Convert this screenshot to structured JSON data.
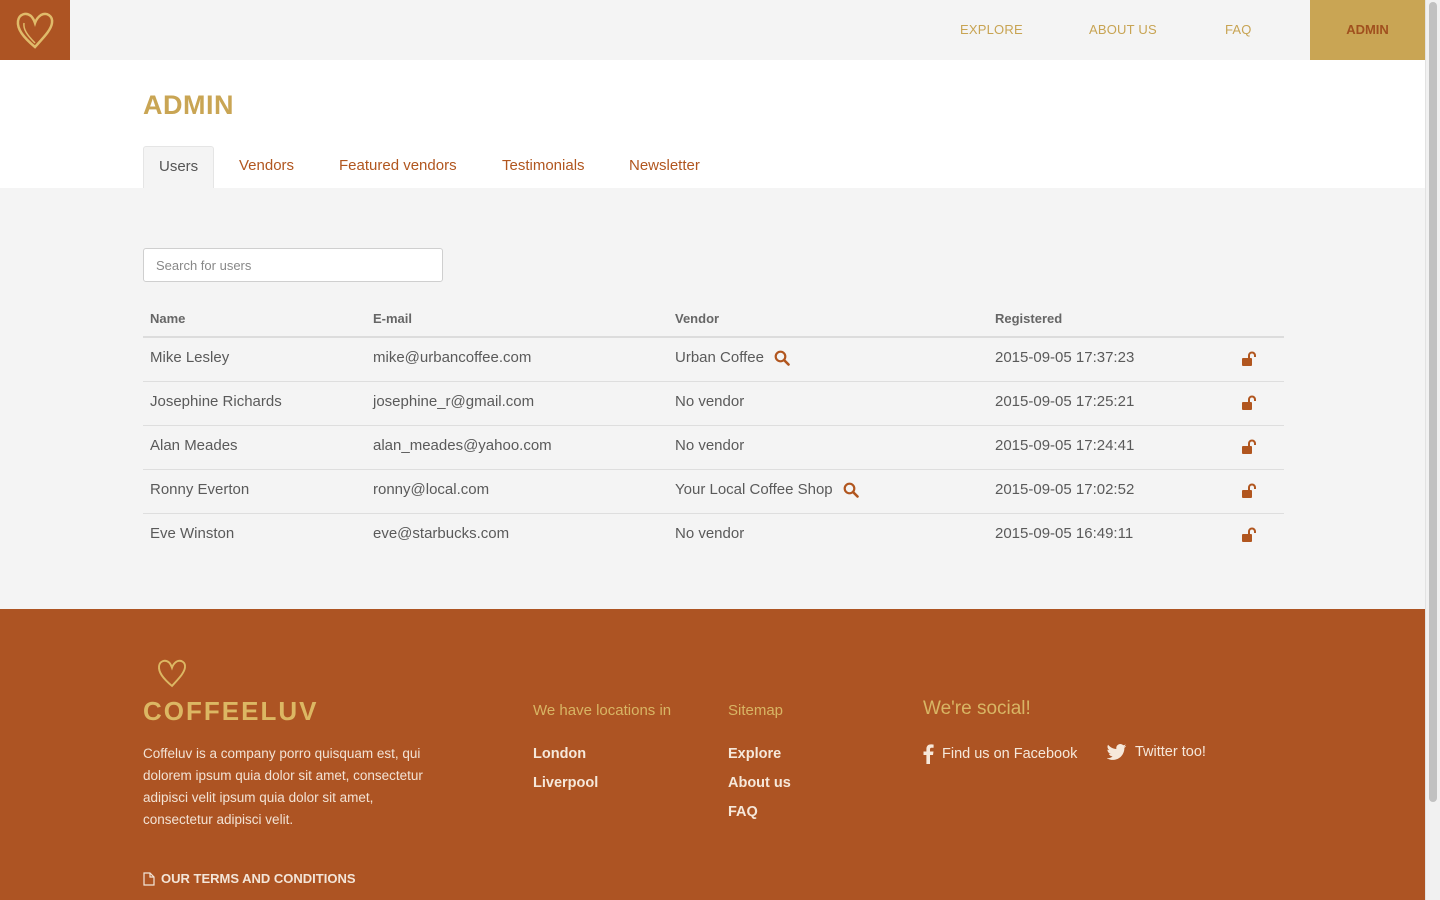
{
  "nav": {
    "items": [
      {
        "label": "EXPLORE"
      },
      {
        "label": "ABOUT US"
      },
      {
        "label": "FAQ"
      }
    ],
    "active_label": "ADMIN"
  },
  "page": {
    "title": "ADMIN",
    "tabs": [
      {
        "label": "Users",
        "active": true
      },
      {
        "label": "Vendors"
      },
      {
        "label": "Featured vendors"
      },
      {
        "label": "Testimonials"
      },
      {
        "label": "Newsletter"
      }
    ]
  },
  "users": {
    "search_placeholder": "Search for users",
    "columns": [
      "Name",
      "E-mail",
      "Vendor",
      "Registered"
    ],
    "rows": [
      {
        "name": "Mike Lesley",
        "email": "mike@urbancoffee.com",
        "vendor": "Urban Coffee",
        "has_vendor": true,
        "registered": "2015-09-05 17:37:23"
      },
      {
        "name": "Josephine Richards",
        "email": "josephine_r@gmail.com",
        "vendor": "No vendor",
        "has_vendor": false,
        "registered": "2015-09-05 17:25:21"
      },
      {
        "name": "Alan Meades",
        "email": "alan_meades@yahoo.com",
        "vendor": "No vendor",
        "has_vendor": false,
        "registered": "2015-09-05 17:24:41"
      },
      {
        "name": "Ronny Everton",
        "email": "ronny@local.com",
        "vendor": "Your Local Coffee Shop",
        "has_vendor": true,
        "registered": "2015-09-05 17:02:52"
      },
      {
        "name": "Eve Winston",
        "email": "eve@starbucks.com",
        "vendor": "No vendor",
        "has_vendor": false,
        "registered": "2015-09-05 16:49:11"
      }
    ]
  },
  "footer": {
    "brand": "COFFEELUV",
    "about": "Coffeluv is a company porro quisquam est, qui dolorem ipsum quia dolor sit amet, consectetur adipisci velit ipsum quia dolor sit amet, consectetur adipisci velit.",
    "terms": "OUR TERMS AND CONDITIONS",
    "locations_title": "We have locations in",
    "locations": [
      "London",
      "Liverpool"
    ],
    "sitemap_title": "Sitemap",
    "sitemap": [
      "Explore",
      "About us",
      "FAQ"
    ],
    "social_title": "We're social!",
    "facebook": "Find us on Facebook",
    "twitter": "Twitter too!"
  },
  "colors": {
    "brand_brown": "#ad5423",
    "brand_gold": "#c9a554",
    "panel_grey": "#f4f4f4"
  },
  "icons": [
    "heart-logo-icon",
    "search-icon",
    "unlock-icon",
    "document-icon",
    "facebook-icon",
    "twitter-icon"
  ]
}
